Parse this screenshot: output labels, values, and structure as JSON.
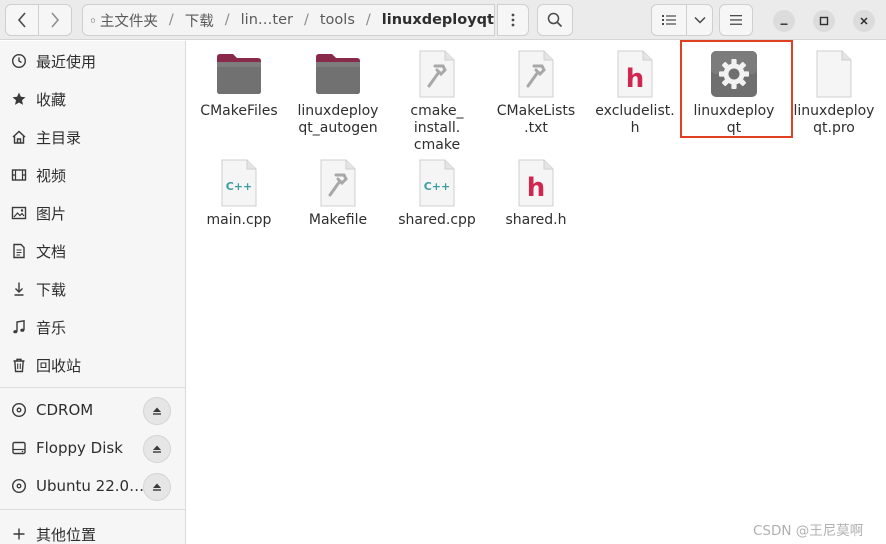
{
  "header": {
    "path": [
      "主文件夹",
      "下载",
      "lin…ter",
      "tools",
      "linuxdeployqt"
    ]
  },
  "sidebar": {
    "places": [
      {
        "label": "最近使用",
        "icon": "clock-icon"
      },
      {
        "label": "收藏",
        "icon": "star-icon"
      },
      {
        "label": "主目录",
        "icon": "home-icon"
      },
      {
        "label": "视频",
        "icon": "film-icon"
      },
      {
        "label": "图片",
        "icon": "picture-icon"
      },
      {
        "label": "文档",
        "icon": "document-icon"
      },
      {
        "label": "下载",
        "icon": "download-icon"
      },
      {
        "label": "音乐",
        "icon": "music-icon"
      },
      {
        "label": "回收站",
        "icon": "trash-icon"
      }
    ],
    "devices": [
      {
        "label": "CDROM",
        "icon": "disc-icon"
      },
      {
        "label": "Floppy Disk",
        "icon": "drive-icon"
      },
      {
        "label": "Ubuntu 22.0…",
        "icon": "disc-icon"
      }
    ],
    "other": {
      "label": "其他位置",
      "icon": "plus-icon"
    }
  },
  "files": [
    {
      "name": "CMakeFiles",
      "type": "folder"
    },
    {
      "name": "linuxdeploy\nqt_autogen",
      "type": "folder"
    },
    {
      "name": "cmake_\ninstall.\ncmake",
      "type": "script"
    },
    {
      "name": "CMakeLists\n.txt",
      "type": "script"
    },
    {
      "name": "excludelist.\nh",
      "type": "header"
    },
    {
      "name": "linuxdeploy\nqt",
      "type": "executable"
    },
    {
      "name": "linuxdeploy\nqt.pro",
      "type": "text"
    },
    {
      "name": "main.cpp",
      "type": "cpp"
    },
    {
      "name": "Makefile",
      "type": "script"
    },
    {
      "name": "shared.cpp",
      "type": "cpp"
    },
    {
      "name": "shared.h",
      "type": "header"
    }
  ],
  "watermark": "CSDN @王尼莫啊"
}
